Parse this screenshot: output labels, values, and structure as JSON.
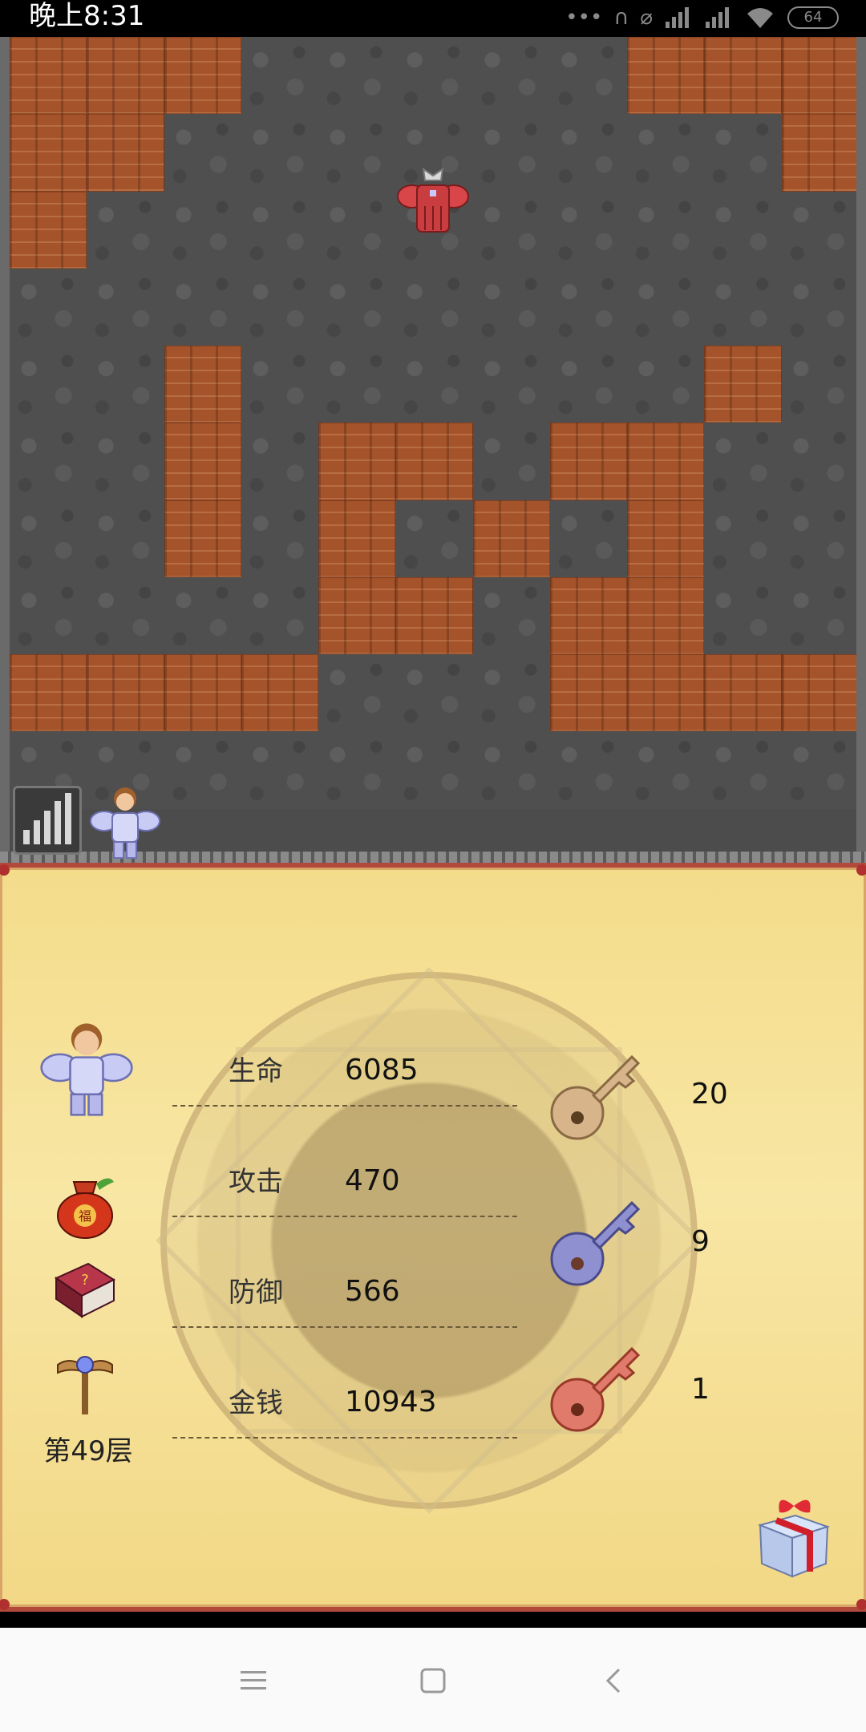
{
  "status_bar": {
    "time": "晚上8:31",
    "battery": "64",
    "icons": [
      "more-dots-icon",
      "headset-icon",
      "mute-icon",
      "hd-signal-icon",
      "hd-signal-icon",
      "wifi-icon",
      "battery-icon"
    ]
  },
  "map": {
    "tile_grid": [
      "WWWF.FFFWWWW",
      "WW.FFFFFF.WW",
      "W.FFFFFFFF.W",
      "FFFFFFFFFFFF",
      "F.W.FFFF.W.F",
      "F.W.WW.WWF.F",
      "F.W.WFWFWF.F",
      "FFF.WWFWW.FF",
      "WWWWFFFWWWWW",
      "FFFFFFFFFFFF"
    ],
    "sprites": [
      "red-armor-knight",
      "hero"
    ]
  },
  "hero": {
    "floor_label": "第49层"
  },
  "stats": [
    {
      "label": "生命",
      "value": "6085"
    },
    {
      "label": "攻击",
      "value": "470"
    },
    {
      "label": "防御",
      "value": "566"
    },
    {
      "label": "金钱",
      "value": "10943"
    }
  ],
  "keys": [
    {
      "color": "yellow",
      "count": "20"
    },
    {
      "color": "blue",
      "count": "9"
    },
    {
      "color": "red",
      "count": "1"
    }
  ],
  "colors": {
    "wall": "#a4532b",
    "floor": "#4f4f4f",
    "panel": "#f8e6a4",
    "key_yellow": "#d8b48a",
    "key_blue": "#8f90d0",
    "key_red": "#e07a6a"
  }
}
